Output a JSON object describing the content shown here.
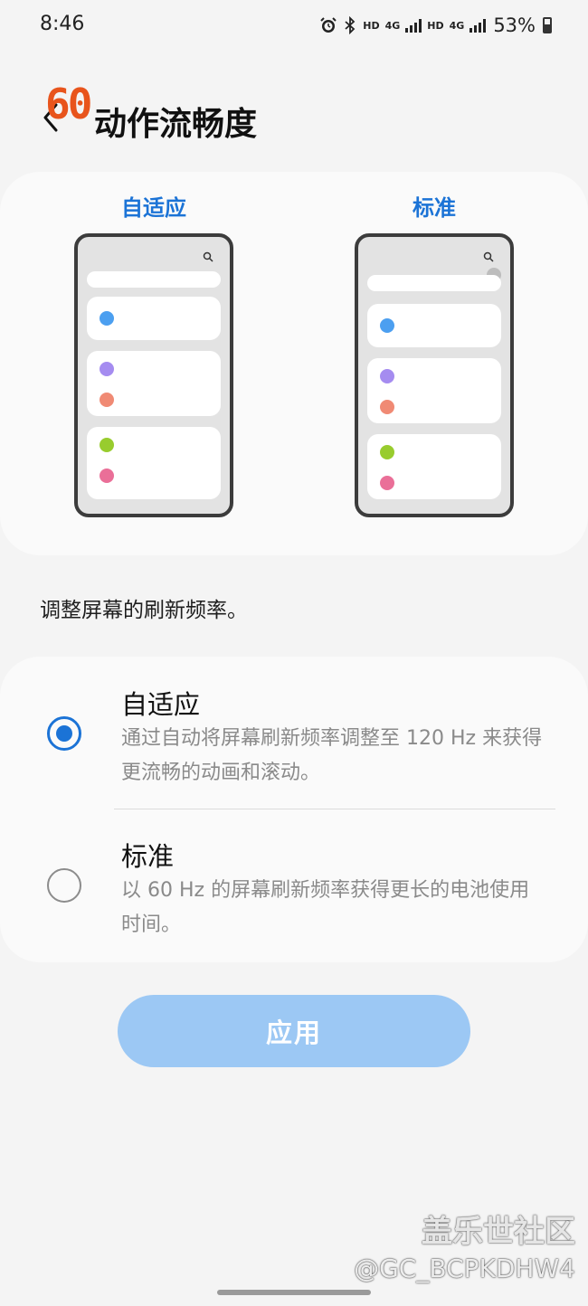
{
  "status_bar": {
    "time": "8:46",
    "hd1": "HD",
    "net1": "4G",
    "hd2": "HD",
    "net2": "4G",
    "battery": "53%",
    "icons": [
      "alarm-icon",
      "bluetooth-icon",
      "signal-icon",
      "battery-icon"
    ]
  },
  "overlay": {
    "fps_badge": "60"
  },
  "header": {
    "title": "动作流畅度"
  },
  "preview": {
    "adaptive_label": "自适应",
    "standard_label": "标准"
  },
  "description": "调整屏幕的刷新频率。",
  "options": [
    {
      "title": "自适应",
      "description": "通过自动将屏幕刷新频率调整至 120 Hz 来获得更流畅的动画和滚动。",
      "selected": true
    },
    {
      "title": "标准",
      "description": "以 60 Hz 的屏幕刷新频率获得更长的电池使用时间。",
      "selected": false
    }
  ],
  "apply_button": "应用",
  "watermark": {
    "line1": "盖乐世社区",
    "line2": "@GC_BCPKDHW4"
  },
  "colors": {
    "accent": "#1b73d6",
    "button_disabled": "#9cc8f4",
    "fps_badge": "#e8541c",
    "dot_blue": "#4c9ff0",
    "dot_purple": "#a58cf0",
    "dot_salmon": "#f08a74",
    "dot_green": "#98cc2e",
    "dot_pink": "#ea6f98"
  }
}
